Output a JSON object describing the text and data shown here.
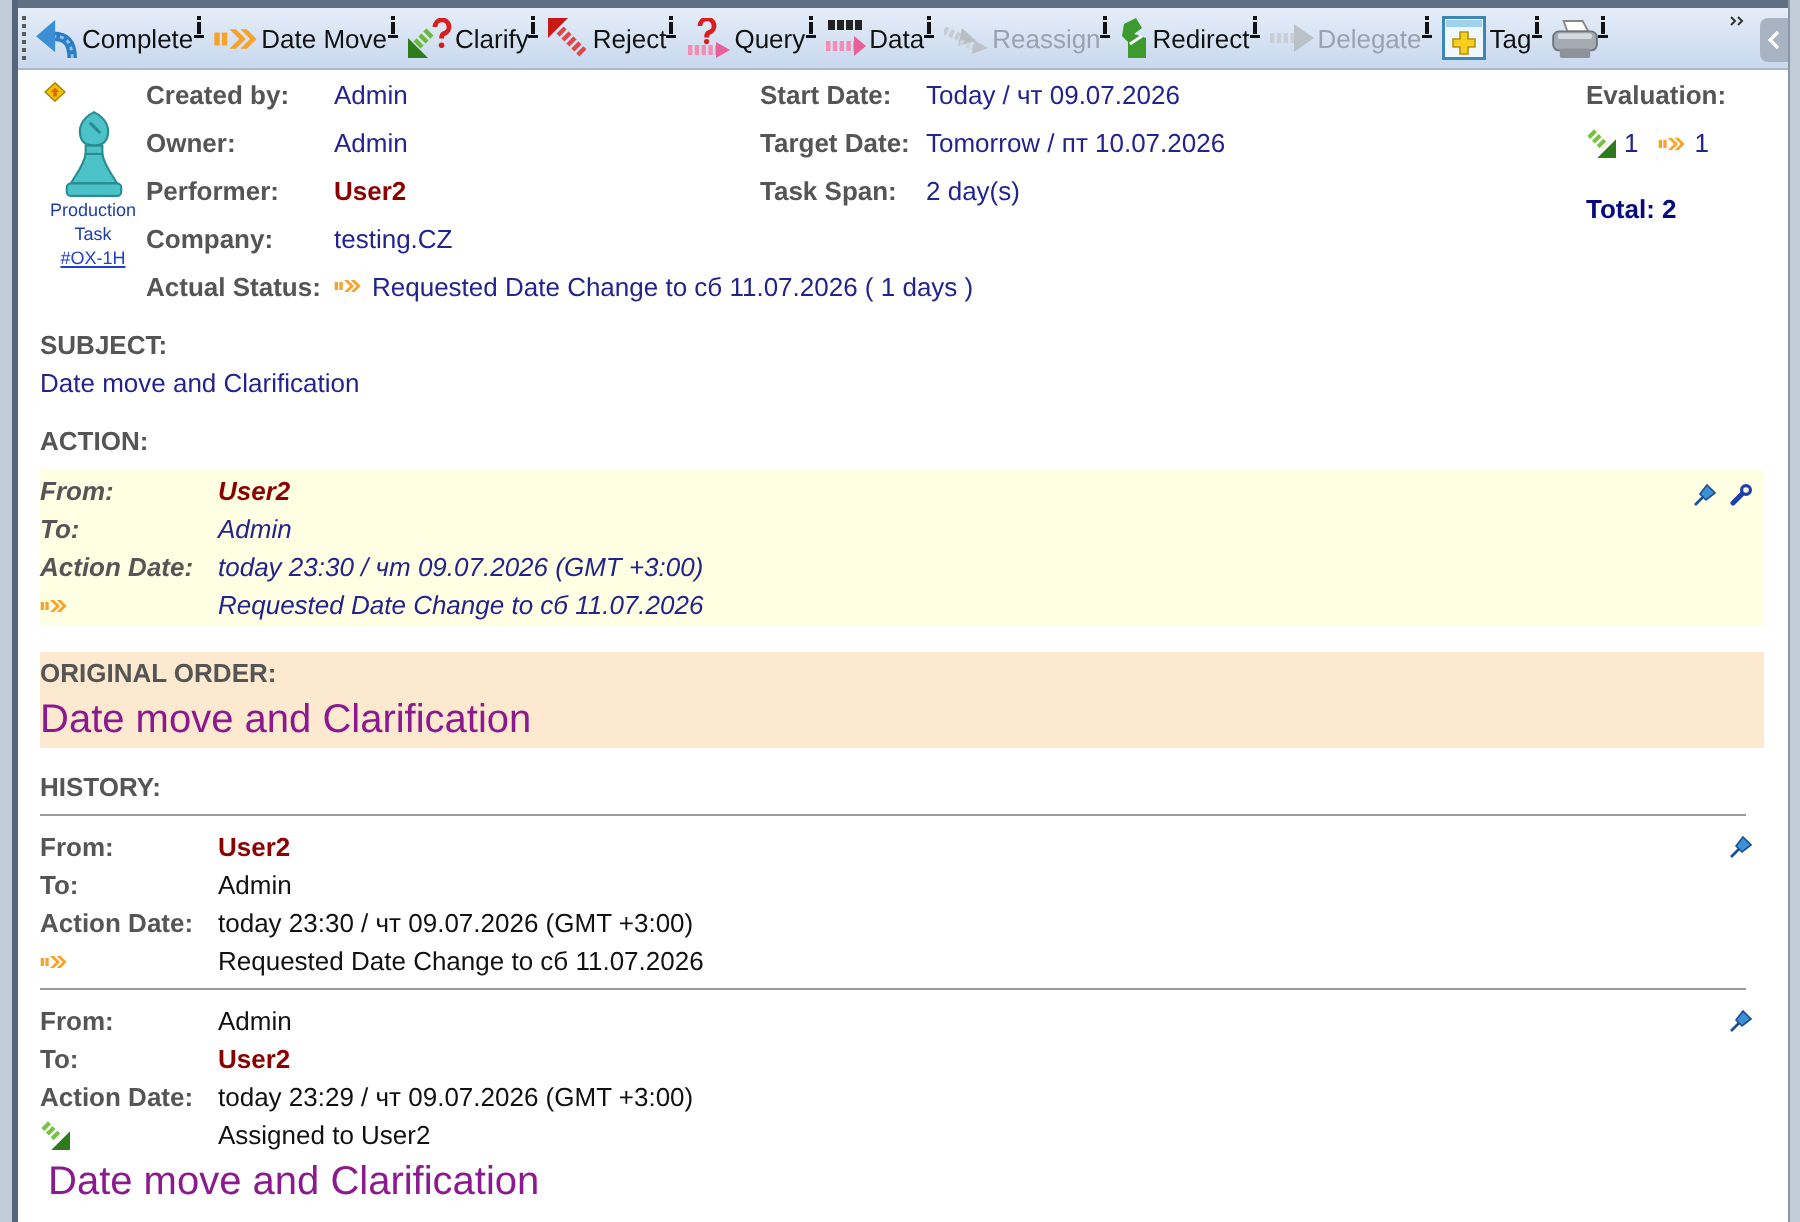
{
  "toolbar": {
    "buttons": [
      {
        "kind": "complete",
        "label": "Complete",
        "disabled": false
      },
      {
        "kind": "datemove",
        "label": "Date Move",
        "disabled": false
      },
      {
        "kind": "clarify",
        "label": "Clarify",
        "disabled": false
      },
      {
        "kind": "reject",
        "label": "Reject",
        "disabled": false
      },
      {
        "kind": "query",
        "label": "Query",
        "disabled": false
      },
      {
        "kind": "data",
        "label": "Data",
        "disabled": false
      },
      {
        "kind": "reassign",
        "label": "Reassign",
        "disabled": true
      },
      {
        "kind": "redirect",
        "label": "Redirect",
        "disabled": false
      },
      {
        "kind": "delegate",
        "label": "Delegate",
        "disabled": true
      },
      {
        "kind": "tag",
        "label": "Tag",
        "disabled": false
      },
      {
        "kind": "print",
        "disabled": false
      }
    ]
  },
  "task": {
    "type": "Production Task",
    "number": "#OX-1H"
  },
  "details": {
    "left": [
      {
        "label": "Created by:",
        "value": "Admin",
        "highlighted": false
      },
      {
        "label": "Owner:",
        "value": "Admin",
        "highlighted": false
      },
      {
        "label": "Performer:",
        "value": "User2",
        "highlighted": true
      },
      {
        "label": "Company:",
        "value": "testing.CZ",
        "highlighted": false
      }
    ],
    "right": [
      {
        "label": "Start Date:",
        "value": "Today / чт 09.07.2026"
      },
      {
        "label": "Target Date:",
        "value": "Tomorrow / пт 10.07.2026"
      },
      {
        "label": "Task Span:",
        "value": "2 day(s)"
      }
    ],
    "status": {
      "label": "Actual Status:",
      "kind": "datemove",
      "value": "Requested Date Change to сб 11.07.2026 ( 1 days )"
    }
  },
  "evaluation": {
    "label": "Evaluation:",
    "counts": [
      {
        "kind": "assign",
        "count": "1"
      },
      {
        "kind": "datemove",
        "count": "1"
      }
    ],
    "total": "Total: 2"
  },
  "subject": {
    "heading": "SUBJECT:",
    "text": "Date move and Clarification"
  },
  "action": {
    "heading": "ACTION:",
    "rows": [
      {
        "label": "From:",
        "value": "User2",
        "highlighted": true
      },
      {
        "label": "To:",
        "value": "Admin",
        "highlighted": false
      },
      {
        "label": "Action Date:",
        "value": "today 23:30 / чт 09.07.2026 (GMT +3:00)",
        "highlighted": false
      }
    ],
    "status": {
      "kind": "datemove",
      "text": "Requested Date Change to сб 11.07.2026"
    }
  },
  "original_order": {
    "heading": "ORIGINAL ORDER:",
    "text": "Date move and Clarification"
  },
  "history": {
    "heading": "HISTORY:",
    "entries": [
      {
        "rows": [
          {
            "label": "From:",
            "value": "User2",
            "highlighted": true
          },
          {
            "label": "To:",
            "value": "Admin",
            "highlighted": false
          },
          {
            "label": "Action Date:",
            "value": "today 23:30 / чт 09.07.2026 (GMT +3:00)",
            "highlighted": false
          }
        ],
        "status": {
          "kind": "datemove",
          "text": "Requested Date Change to сб 11.07.2026"
        }
      },
      {
        "rows": [
          {
            "label": "From:",
            "value": "Admin",
            "highlighted": false
          },
          {
            "label": "To:",
            "value": "User2",
            "highlighted": true
          },
          {
            "label": "Action Date:",
            "value": "today 23:29 / чт 09.07.2026 (GMT +3:00)",
            "highlighted": false
          }
        ],
        "status": {
          "kind": "assign",
          "text": "Assigned to User2"
        },
        "message": "Date move and Clarification"
      }
    ]
  }
}
